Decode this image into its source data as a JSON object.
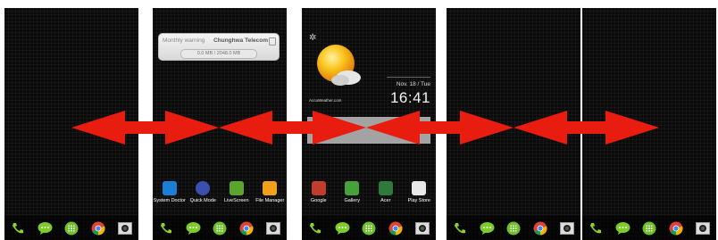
{
  "data_widget": {
    "title": "Monthly warning",
    "carrier": "Chunghwa Telecom",
    "usage": "0.0 MB / 2048.0 MB"
  },
  "weather_clock": {
    "date": "Nov. 18 / Tue",
    "time": "16:41",
    "source": "AccuWeather.com"
  },
  "panel2_apps": [
    {
      "label": "System Doctor",
      "icon": "system-doctor-icon",
      "color": "#1c7fd6"
    },
    {
      "label": "Quick Mode",
      "icon": "quick-mode-icon",
      "color": "#3a4fb0"
    },
    {
      "label": "LiveScreen",
      "icon": "livescreen-icon",
      "color": "#5aa62c"
    },
    {
      "label": "File Manager",
      "icon": "file-manager-icon",
      "color": "#f0a01a"
    }
  ],
  "panel3_apps": [
    {
      "label": "Google",
      "icon": "google-folder-icon",
      "color": "#c23b2b"
    },
    {
      "label": "Gallery",
      "icon": "gallery-icon",
      "color": "#46a13a"
    },
    {
      "label": "Acer",
      "icon": "acer-folder-icon",
      "color": "#2f7a3a"
    },
    {
      "label": "Play Store",
      "icon": "play-store-icon",
      "color": "#e8e8e8"
    }
  ],
  "dock_icons": [
    "phone-icon",
    "messaging-icon",
    "app-drawer-icon",
    "chrome-icon",
    "camera-icon"
  ],
  "colors": {
    "arrow": "#e81c0f",
    "background": "#0b0b0b"
  }
}
